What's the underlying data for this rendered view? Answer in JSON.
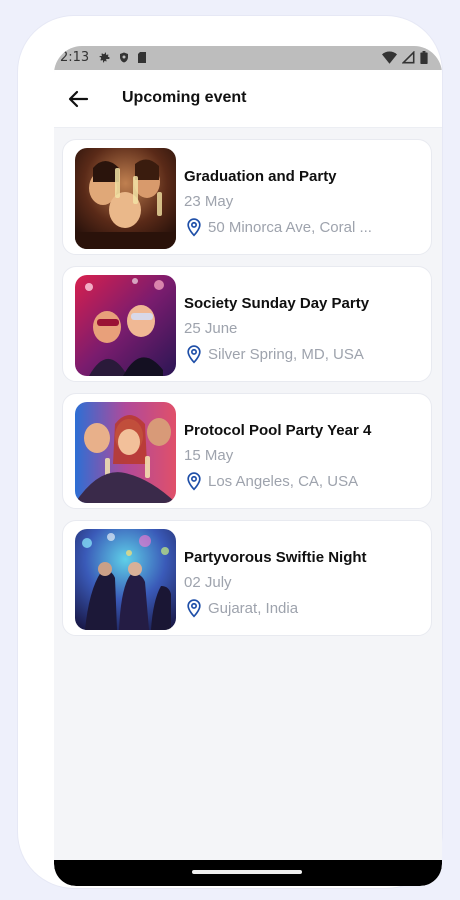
{
  "status_bar": {
    "time": "2:13",
    "left_icons": [
      "gear-icon",
      "shield-icon",
      "sd-card-icon"
    ],
    "right_icons": [
      "wifi-icon",
      "signal-icon",
      "battery-icon"
    ]
  },
  "header": {
    "back_icon": "arrow-left-icon",
    "title": "Upcoming event"
  },
  "events": [
    {
      "title": "Graduation and Party",
      "date": "23 May",
      "location": "50 Minorca Ave, Coral ..."
    },
    {
      "title": "Society Sunday Day Party",
      "date": "25 June",
      "location": "Silver Spring, MD, USA"
    },
    {
      "title": "Protocol Pool Party Year 4",
      "date": "15 May",
      "location": "Los Angeles, CA, USA"
    },
    {
      "title": "Partyvorous Swiftie Night",
      "date": "02 July",
      "location": "Gujarat, India"
    }
  ],
  "colors": {
    "accent": "#1f4fa8",
    "muted_text": "#9ea3ad",
    "background": "#f4f5f8"
  }
}
